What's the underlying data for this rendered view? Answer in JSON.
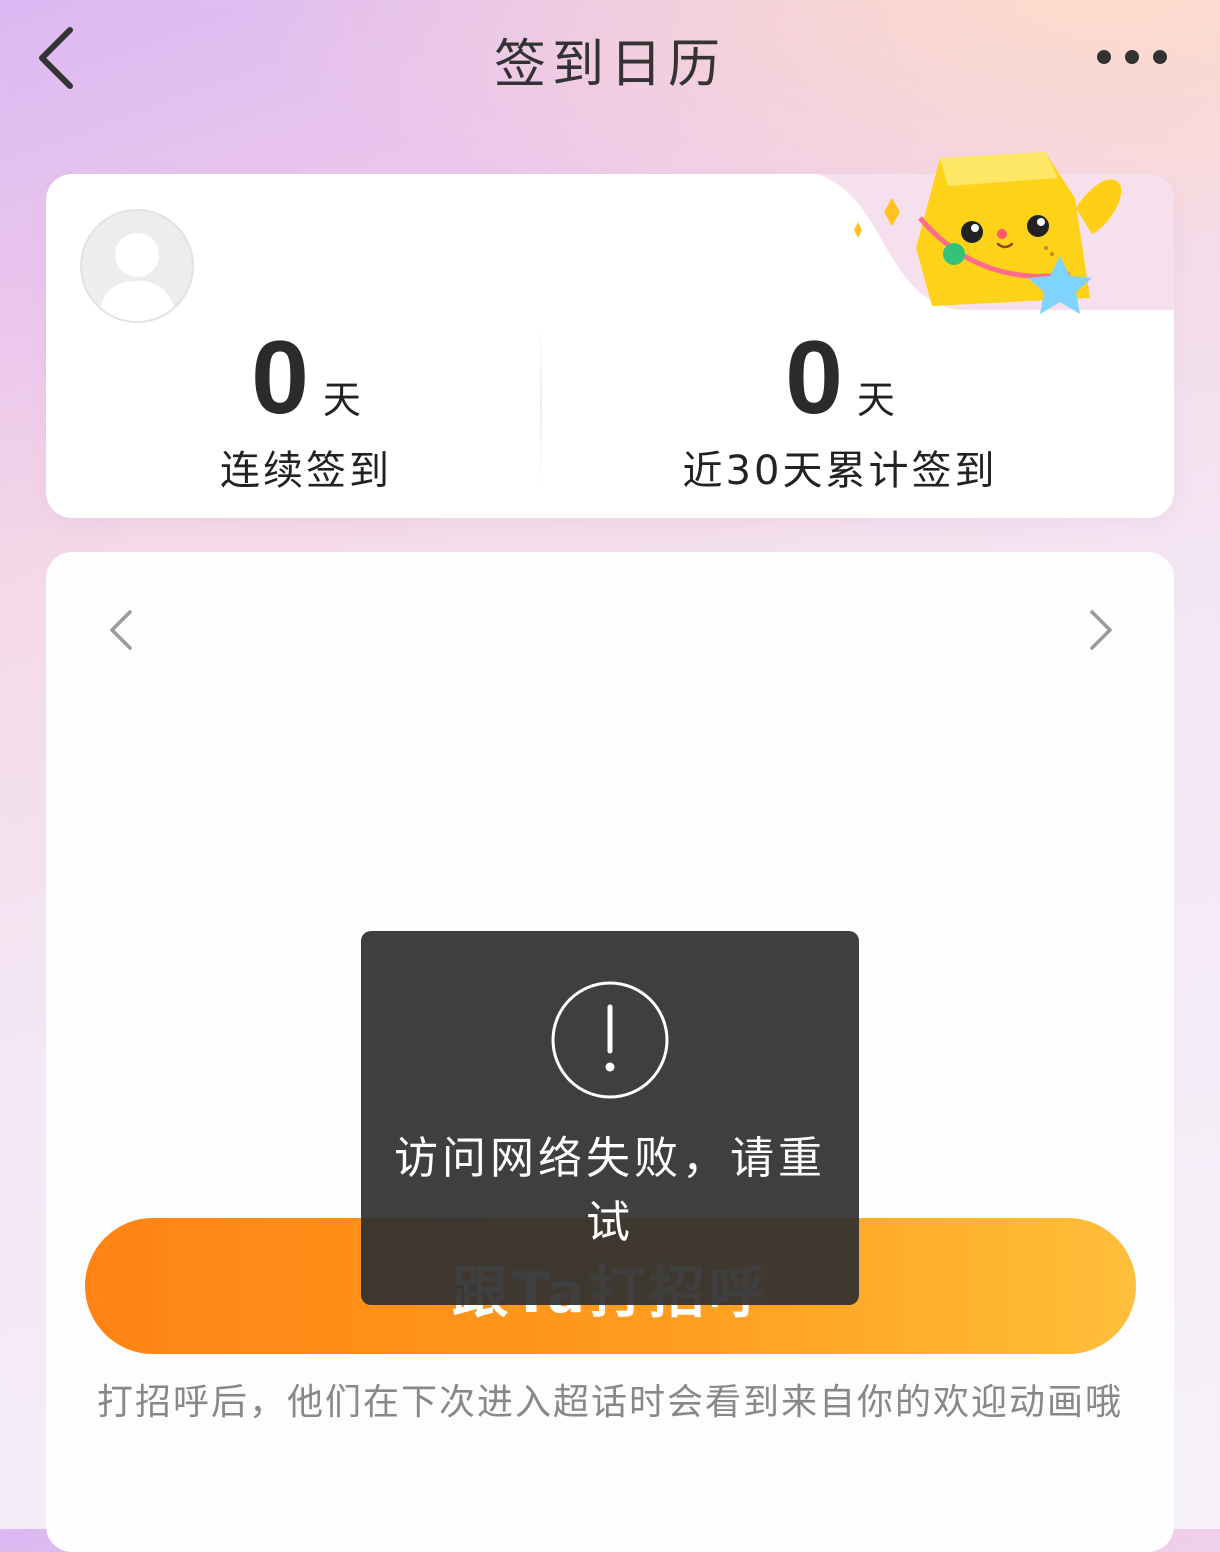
{
  "header": {
    "title": "签到日历"
  },
  "stats": {
    "streak": {
      "value": "0",
      "unit": "天",
      "label": "连续签到"
    },
    "total_30": {
      "value": "0",
      "unit": "天",
      "label": "近30天累计签到"
    }
  },
  "calendar": {
    "prev_icon": "chevron-left-icon",
    "next_icon": "chevron-right-icon"
  },
  "greet": {
    "button_label": "跟Ta打招呼",
    "hint": "打招呼后，他们在下次进入超话时会看到来自你的欢迎动画哦"
  },
  "toast": {
    "icon": "exclamation-circle-icon",
    "message": "访问网络失败，请重试"
  },
  "colors": {
    "accent_start": "#ff8314",
    "accent_end": "#ffbf3a",
    "toast_bg": "#303030"
  }
}
